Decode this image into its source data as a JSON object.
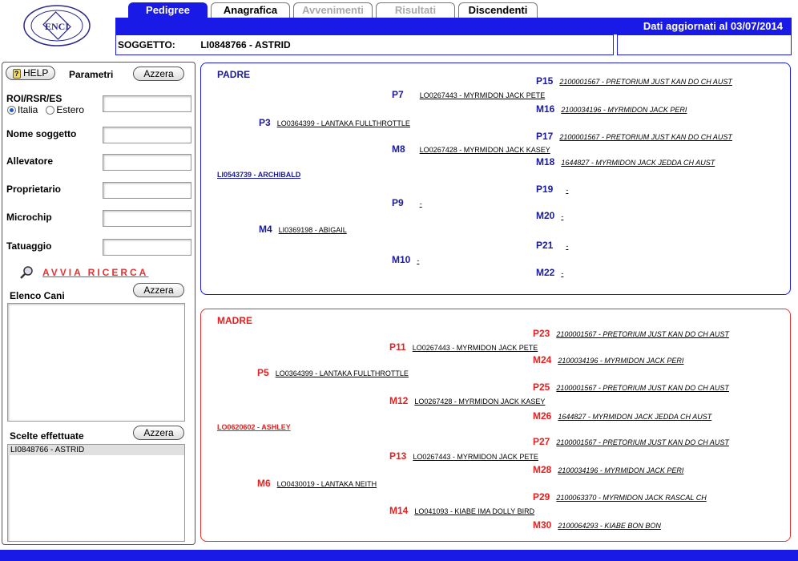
{
  "tabs": [
    {
      "label": "Pedigree",
      "state": "active"
    },
    {
      "label": "Anagrafica",
      "state": "normal"
    },
    {
      "label": "Avvenimenti",
      "state": "disabled"
    },
    {
      "label": "Risultati",
      "state": "disabled"
    },
    {
      "label": "Discendenti",
      "state": "normal"
    }
  ],
  "header": {
    "updated": "Dati aggiornati al 03/07/2014",
    "soggetto_label": "SOGGETTO:",
    "soggetto_value": "LI0848766 - ASTRID",
    "logo_text": "ENCI"
  },
  "left": {
    "help": "HELP",
    "parametri": "Parametri",
    "azzera": "Azzera",
    "roi_label": "ROI/RSR/ES",
    "radio_italia": "Italia",
    "radio_estero": "Estero",
    "nome_soggetto": "Nome soggetto",
    "allevatore": "Allevatore",
    "proprietario": "Proprietario",
    "microchip": "Microchip",
    "tatuaggio": "Tatuaggio",
    "avvia": "AVVIA RICERCA",
    "elenco_cani": "Elenco Cani",
    "scelte": "Scelte effettuate",
    "scelte_items": [
      "LI0848766 - ASTRID"
    ]
  },
  "padre": {
    "title": "PADRE",
    "root": "LI0543739 - ARCHIBALD",
    "P3": "LO0364399 - LANTAKA FULLTHROTTLE",
    "M4": "LI0369198 - ABIGAIL",
    "P7": "LO0267443 - MYRMIDON JACK PETE",
    "M8": "LO0267428 - MYRMIDON JACK KASEY",
    "P9": "-",
    "M10": "-",
    "P15": "2100001567 - PRETORIUM JUST KAN DO CH AUST",
    "M16": "2100034196 - MYRMIDON JACK PERI",
    "P17": "2100001567 - PRETORIUM JUST KAN DO CH AUST",
    "M18": "1644827 - MYRMIDON JACK JEDDA CH AUST",
    "P19": "-",
    "M20": "-",
    "P21": "-",
    "M22": "-"
  },
  "madre": {
    "title": "MADRE",
    "root": "LO0620602 - ASHLEY",
    "P5": "LO0364399 - LANTAKA FULLTHROTTLE",
    "M6": "LO0430019 - LANTAKA NEITH",
    "P11": "LO0267443 - MYRMIDON JACK PETE",
    "M12": "LO0267428 - MYRMIDON JACK KASEY",
    "P13": "LO0267443 - MYRMIDON JACK PETE",
    "M14": "LO041093 - KIABE IMA DOLLY BIRD",
    "P23": "2100001567 - PRETORIUM JUST KAN DO CH AUST",
    "M24": "2100034196 - MYRMIDON JACK PERI",
    "P25": "2100001567 - PRETORIUM JUST KAN DO CH AUST",
    "M26": "1644827 - MYRMIDON JACK JEDDA CH AUST",
    "P27": "2100001567 - PRETORIUM JUST KAN DO CH AUST",
    "M28": "2100034196 - MYRMIDON JACK PERI",
    "P29": "2100063370 - MYRMIDON JACK RASCAL CH",
    "M30": "2100064293 - KIABE BON BON"
  },
  "codes": {
    "P3": "P3",
    "M4": "M4",
    "P7": "P7",
    "M8": "M8",
    "P9": "P9",
    "M10": "M10",
    "P15": "P15",
    "M16": "M16",
    "P17": "P17",
    "M18": "M18",
    "P19": "P19",
    "M20": "M20",
    "P21": "P21",
    "M22": "M22",
    "P5": "P5",
    "M6": "M6",
    "P11": "P11",
    "M12": "M12",
    "P13": "P13",
    "M14": "M14",
    "P23": "P23",
    "M24": "M24",
    "P25": "P25",
    "M26": "M26",
    "P27": "P27",
    "M28": "M28",
    "P29": "P29",
    "M30": "M30"
  },
  "colors": {
    "brand_blue": "#1a1ae6",
    "madre_red": "#e63232",
    "padre_blue": "#1a1a9a"
  }
}
